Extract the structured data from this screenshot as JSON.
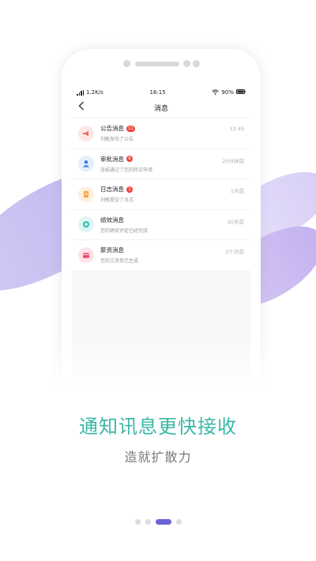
{
  "status_bar": {
    "speed": "1.2K/s",
    "time": "16:15",
    "battery": "90%"
  },
  "nav": {
    "title": "消息",
    "back_icon": "chevron-left-icon"
  },
  "messages": [
    {
      "title": "公告消息",
      "badge": "12",
      "subtitle": "刘敏发布了公告",
      "time": "13:49",
      "icon": "megaphone-icon",
      "color": "#f06a5a"
    },
    {
      "title": "审批消息",
      "badge": "8",
      "subtitle": "张娟通过了您的转正申请",
      "time": "20分钟前",
      "icon": "person-icon",
      "color": "#3a7bea"
    },
    {
      "title": "日志消息",
      "badge": "1",
      "subtitle": "刘敏提交了日志",
      "time": "1天前",
      "icon": "journal-icon",
      "color": "#f6a13a"
    },
    {
      "title": "绩效消息",
      "badge": "",
      "subtitle": "您的绩效评定已经完成",
      "time": "20天前",
      "icon": "performance-icon",
      "color": "#2fbfb0"
    },
    {
      "title": "薪资消息",
      "badge": "",
      "subtitle": "您的工资单已生成",
      "time": "3个月前",
      "icon": "wallet-icon",
      "color": "#ee4a6b"
    }
  ],
  "headline": "通知讯息更快接收",
  "subheadline": "造就扩散力",
  "pagination": {
    "total": 4,
    "active": 3
  },
  "colors": {
    "accent": "#3bb8a7",
    "dot_active": "#6a63d8"
  }
}
